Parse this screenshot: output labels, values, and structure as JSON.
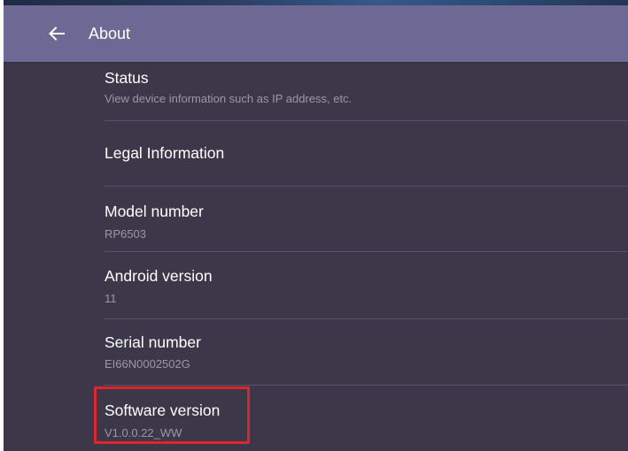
{
  "appbar": {
    "back_icon": "arrow-left-icon",
    "title": "About"
  },
  "items": [
    {
      "title": "Status",
      "subtitle": "View device information such as IP address, etc."
    },
    {
      "title": "Legal Information",
      "subtitle": ""
    },
    {
      "title": "Model number",
      "subtitle": "RP6503"
    },
    {
      "title": "Android version",
      "subtitle": "11"
    },
    {
      "title": "Serial number",
      "subtitle": "EI66N0002502G"
    },
    {
      "title": "Software version",
      "subtitle": "V1.0.0.22_WW"
    }
  ],
  "colors": {
    "appbar": "#6e6994",
    "background": "#3c3849",
    "highlight": "#e0242b"
  }
}
